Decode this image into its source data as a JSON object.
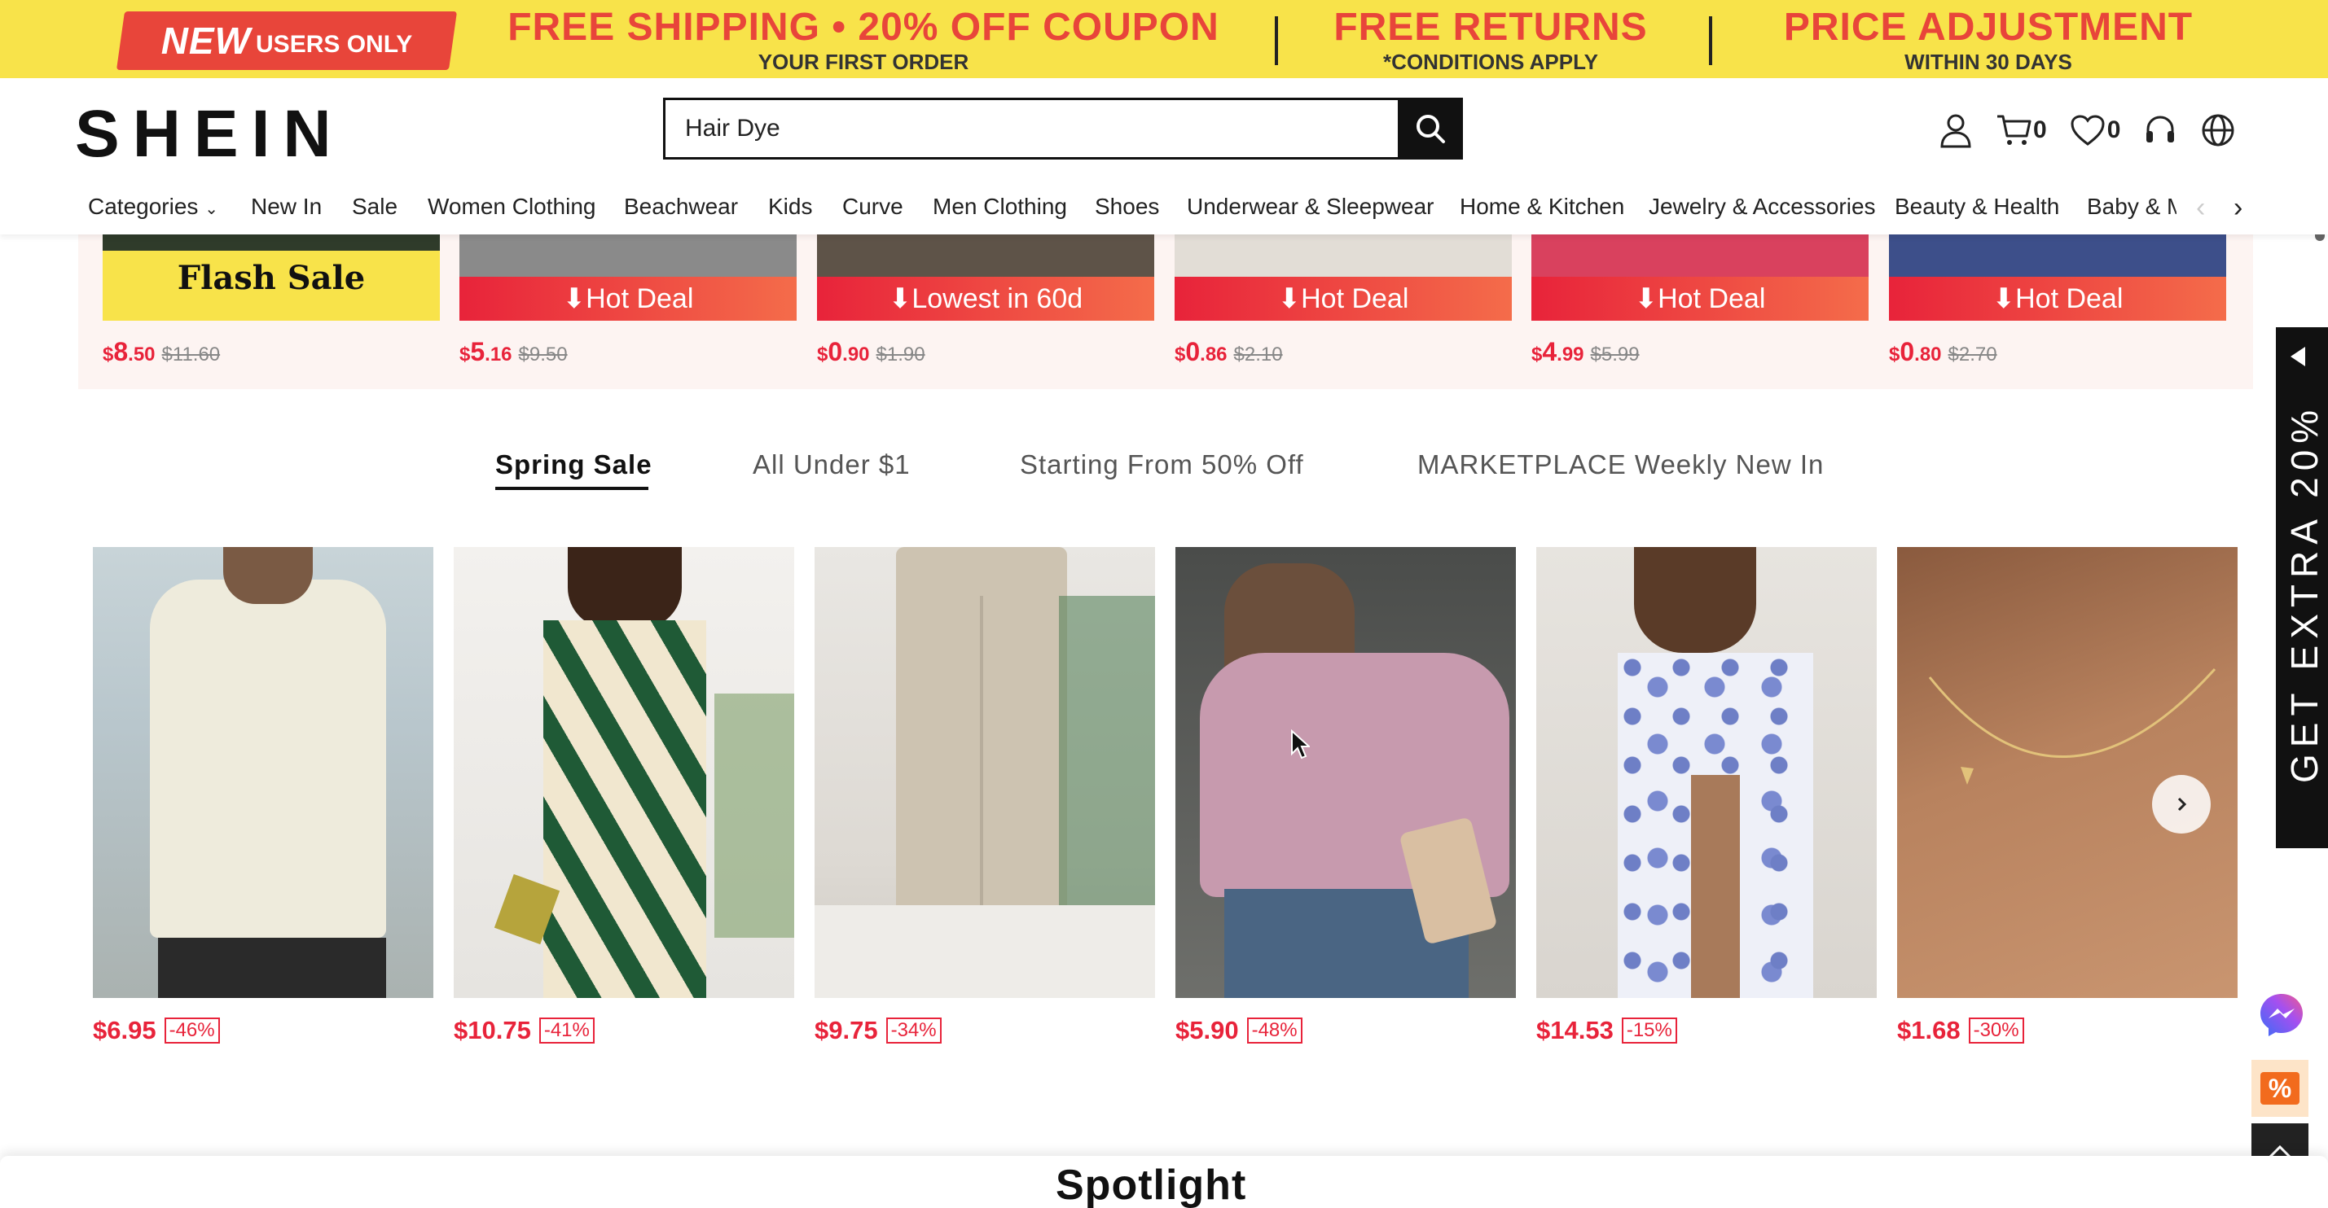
{
  "promo": {
    "badge_big": "NEW",
    "badge_small": "USERS ONLY",
    "blocks": [
      {
        "title": "FREE SHIPPING • 20% OFF COUPON",
        "sub": "YOUR FIRST ORDER"
      },
      {
        "title": "FREE RETURNS",
        "sub": "*CONDITIONS APPLY"
      },
      {
        "title": "PRICE ADJUSTMENT",
        "sub": "WITHIN 30 DAYS"
      }
    ]
  },
  "header": {
    "logo": "SHEIN",
    "search_value": "Hair Dye",
    "cart_count": "0",
    "wishlist_count": "0"
  },
  "nav": {
    "items": [
      "Categories",
      "New In",
      "Sale",
      "Women Clothing",
      "Beachwear",
      "Kids",
      "Curve",
      "Men Clothing",
      "Shoes",
      "Underwear & Sleepwear",
      "Home & Kitchen",
      "Jewelry & Accessories",
      "Beauty & Health",
      "Baby & M"
    ]
  },
  "flash": {
    "cards": [
      {
        "label": "Flash Sale",
        "cur": "$",
        "int": "8",
        "dec": ".50",
        "old": "$11.60"
      },
      {
        "label": "Hot Deal",
        "cur": "$",
        "int": "5",
        "dec": ".16",
        "old": "$9.50"
      },
      {
        "label": "Lowest in 60d",
        "cur": "$",
        "int": "0",
        "dec": ".90",
        "old": "$1.90"
      },
      {
        "label": "Hot Deal",
        "cur": "$",
        "int": "0",
        "dec": ".86",
        "old": "$2.10"
      },
      {
        "label": "Hot Deal",
        "cur": "$",
        "int": "4",
        "dec": ".99",
        "old": "$5.99"
      },
      {
        "label": "Hot Deal",
        "cur": "$",
        "int": "0",
        "dec": ".80",
        "old": "$2.70"
      }
    ]
  },
  "tabs": [
    "Spring Sale",
    "All Under $1",
    "Starting From 50% Off",
    "MARKETPLACE Weekly New In"
  ],
  "products": [
    {
      "price": "$6.95",
      "discount": "-46%"
    },
    {
      "price": "$10.75",
      "discount": "-41%"
    },
    {
      "price": "$9.75",
      "discount": "-34%"
    },
    {
      "price": "$5.90",
      "discount": "-48%"
    },
    {
      "price": "$14.53",
      "discount": "-15%"
    },
    {
      "price": "$1.68",
      "discount": "-30%"
    }
  ],
  "side": {
    "extra_text": "GET EXTRA 20%",
    "icons": [
      "messenger-icon",
      "coupon-percent-icon",
      "back-to-top-icon"
    ]
  },
  "section": {
    "title": "Spotlight"
  },
  "colors": {
    "accent_red": "#e8233a",
    "banner_yellow": "#f8e34a",
    "text_dark": "#111111"
  }
}
